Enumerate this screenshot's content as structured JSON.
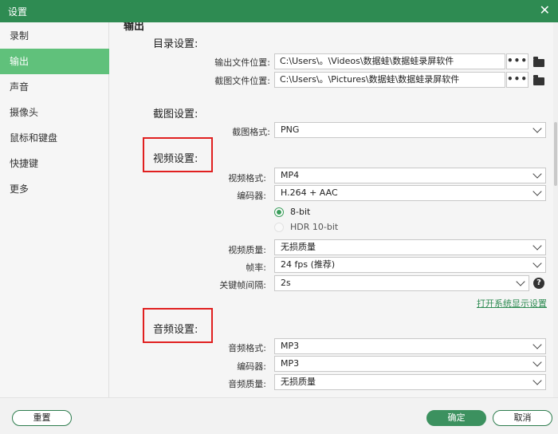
{
  "window": {
    "title": "设置",
    "close_glyph": "✕"
  },
  "sidebar": {
    "items": [
      {
        "label": "录制"
      },
      {
        "label": "输出",
        "active": true
      },
      {
        "label": "声音"
      },
      {
        "label": "摄像头"
      },
      {
        "label": "鼠标和键盘"
      },
      {
        "label": "快捷键"
      },
      {
        "label": "更多"
      }
    ]
  },
  "output": {
    "partial_heading": "输出",
    "directory": {
      "heading": "目录设置:",
      "output_location_label": "输出文件位置:",
      "output_location_value": "C:\\Users\\。\\Videos\\数据蛙\\数据蛙录屏软件",
      "screenshot_location_label": "截图文件位置:",
      "screenshot_location_value": "C:\\Users\\。\\Pictures\\数据蛙\\数据蛙录屏软件",
      "browse_glyph": "•••"
    },
    "screenshot": {
      "heading": "截图设置:",
      "format_label": "截图格式:",
      "format_value": "PNG"
    },
    "video": {
      "heading": "视频设置:",
      "format_label": "视频格式:",
      "format_value": "MP4",
      "encoder_label": "编码器:",
      "encoder_value": "H.264 + AAC",
      "bit_options": [
        "8-bit",
        "HDR 10-bit"
      ],
      "bit_selected": "8-bit",
      "quality_label": "视频质量:",
      "quality_value": "无损质量",
      "framerate_label": "帧率:",
      "framerate_value": "24 fps (推荐)",
      "keyframe_label": "关键帧间隔:",
      "keyframe_value": "2s",
      "help_glyph": "?",
      "display_settings_link": "打开系统显示设置"
    },
    "audio": {
      "heading": "音频设置:",
      "format_label": "音频格式:",
      "format_value": "MP3",
      "encoder_label": "编码器:",
      "encoder_value": "MP3",
      "quality_label": "音频质量:",
      "quality_value": "无损质量"
    }
  },
  "footer": {
    "reset_label": "重置",
    "ok_label": "确定",
    "cancel_label": "取消"
  },
  "colors": {
    "titlebar": "#2e8b52",
    "sidebar_active": "#60c17b",
    "highlight_box": "#e02020",
    "link": "#2e8b52"
  }
}
